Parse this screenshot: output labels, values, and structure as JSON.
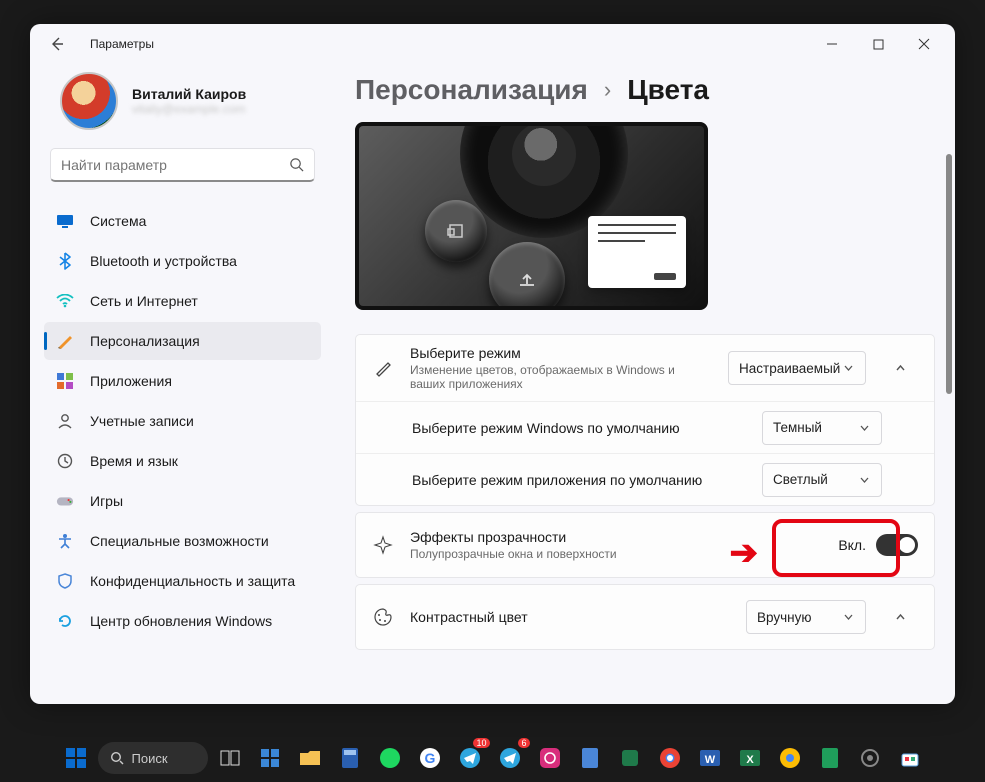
{
  "window": {
    "title": "Параметры"
  },
  "user": {
    "name": "Виталий Каиров",
    "email": "vitaliy@example.com"
  },
  "search": {
    "placeholder": "Найти параметр"
  },
  "nav": [
    {
      "label": "Система",
      "icon": "monitor"
    },
    {
      "label": "Bluetooth и устройства",
      "icon": "bluetooth"
    },
    {
      "label": "Сеть и Интернет",
      "icon": "wifi"
    },
    {
      "label": "Персонализация",
      "icon": "brush",
      "active": true
    },
    {
      "label": "Приложения",
      "icon": "apps"
    },
    {
      "label": "Учетные записи",
      "icon": "user"
    },
    {
      "label": "Время и язык",
      "icon": "clock"
    },
    {
      "label": "Игры",
      "icon": "game"
    },
    {
      "label": "Специальные возможности",
      "icon": "access"
    },
    {
      "label": "Конфиденциальность и защита",
      "icon": "shield"
    },
    {
      "label": "Центр обновления Windows",
      "icon": "update"
    }
  ],
  "breadcrumb": {
    "parent": "Персонализация",
    "current": "Цвета"
  },
  "mode": {
    "title": "Выберите режим",
    "sub": "Изменение цветов, отображаемых в Windows и ваших приложениях",
    "value": "Настраиваемый",
    "sub1": {
      "label": "Выберите режим Windows по умолчанию",
      "value": "Темный"
    },
    "sub2": {
      "label": "Выберите режим приложения по умолчанию",
      "value": "Светлый"
    }
  },
  "transparency": {
    "title": "Эффекты прозрачности",
    "sub": "Полупрозрачные окна и поверхности",
    "state": "Вкл."
  },
  "accent": {
    "title": "Контрастный цвет",
    "value": "Вручную"
  },
  "taskbar": {
    "search": "Поиск"
  }
}
